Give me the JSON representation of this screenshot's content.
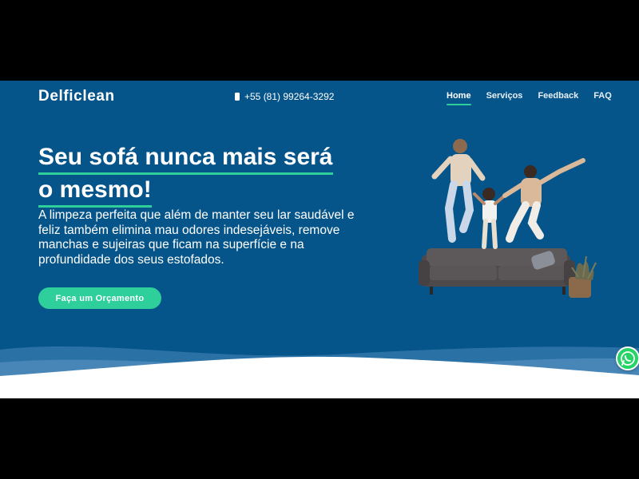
{
  "header": {
    "brand": "Delficlean",
    "phone": "+55 (81) 99264-3292",
    "nav": [
      {
        "label": "Home",
        "active": true
      },
      {
        "label": "Serviços",
        "active": false
      },
      {
        "label": "Feedback",
        "active": false
      },
      {
        "label": "FAQ",
        "active": false
      }
    ]
  },
  "hero": {
    "headline_line1": "Seu sofá nunca mais será",
    "headline_line2": "o mesmo!",
    "description": "A limpeza perfeita que além de manter seu lar saudável e feliz também elimina mau odores indesejáveis, remove manchas e sujeiras que ficam na superfície e na profundidade dos seus estofados.",
    "cta_label": "Faça um Orçamento"
  },
  "icons": {
    "phone": "phone-icon",
    "whatsapp": "whatsapp-icon"
  },
  "colors": {
    "hero_background": "#06558a",
    "accent": "#2ecf9a",
    "whatsapp": "#25d366"
  }
}
